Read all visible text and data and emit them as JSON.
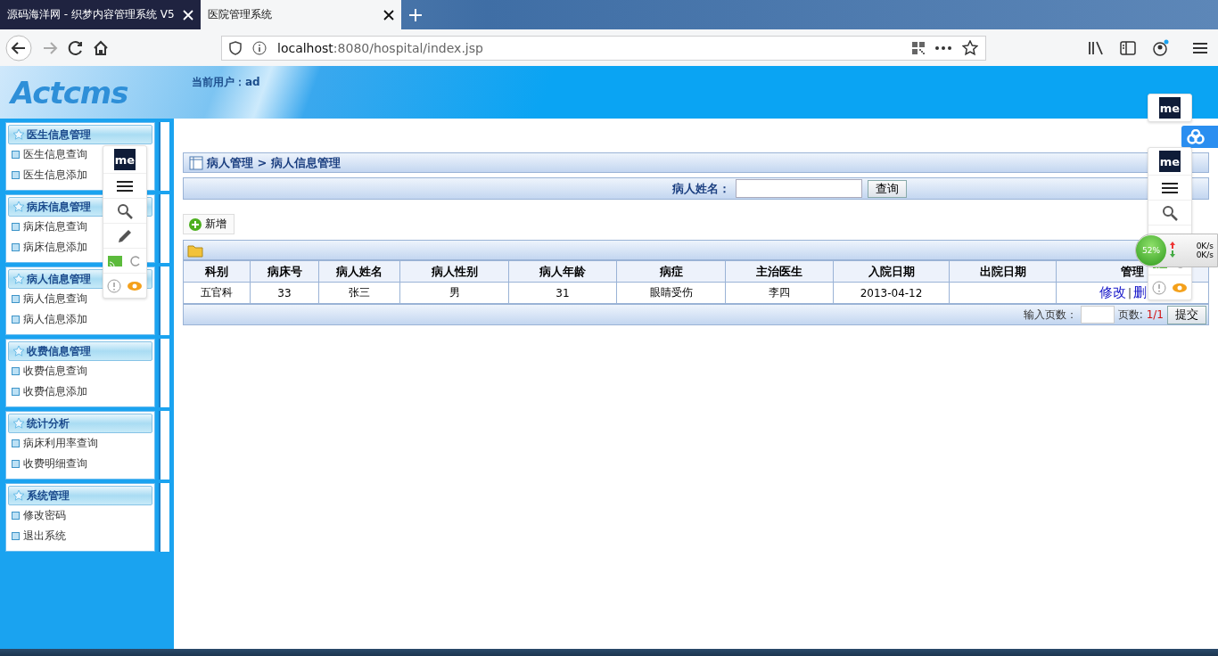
{
  "browser": {
    "tabs": [
      {
        "title": "源码海洋网 - 织梦内容管理系统 V5",
        "selected": false
      },
      {
        "title": "医院管理系统",
        "selected": true
      }
    ],
    "address": {
      "host": "localhost",
      "path": ":8080/hospital/index.jsp"
    }
  },
  "header": {
    "logo": "Actcms",
    "user_label": "当前用户：ad"
  },
  "sidebar": [
    {
      "title": "医生信息管理",
      "items": [
        "医生信息查询",
        "医生信息添加"
      ]
    },
    {
      "title": "病床信息管理",
      "items": [
        "病床信息查询",
        "病床信息添加"
      ]
    },
    {
      "title": "病人信息管理",
      "items": [
        "病人信息查询",
        "病人信息添加"
      ]
    },
    {
      "title": "收费信息管理",
      "items": [
        "收费信息查询",
        "收费信息添加"
      ]
    },
    {
      "title": "统计分析",
      "items": [
        "病床利用率查询",
        "收费明细查询"
      ]
    },
    {
      "title": "系统管理",
      "items": [
        "修改密码",
        "退出系统"
      ]
    }
  ],
  "content": {
    "breadcrumb": "病人管理 > 病人信息管理",
    "search": {
      "label": "病人姓名：",
      "button": "查询"
    },
    "add_button": "新增",
    "table": {
      "columns": [
        "科别",
        "病床号",
        "病人姓名",
        "病人性别",
        "病人年龄",
        "病症",
        "主治医生",
        "入院日期",
        "出院日期",
        "管理"
      ],
      "rows": [
        {
          "cells": [
            "五官科",
            "33",
            "张三",
            "男",
            "31",
            "眼睛受伤",
            "李四",
            "2013-04-12",
            ""
          ],
          "actions": [
            "修改",
            "删"
          ],
          "separator": "|"
        }
      ]
    },
    "pager": {
      "label": "输入页数：",
      "pages_label": "页数:",
      "pages": "1/1",
      "submit": "提交"
    }
  },
  "extension": {
    "panels": [
      {
        "logo": "me"
      },
      {
        "logo": "me"
      },
      {
        "logo": "me"
      }
    ],
    "speed": {
      "percent": "52%",
      "up": "0K/s",
      "down": "0K/s"
    }
  }
}
